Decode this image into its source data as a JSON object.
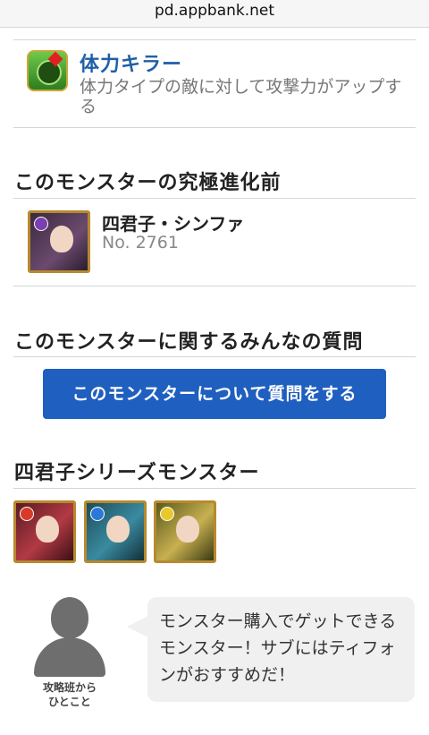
{
  "browser": {
    "url": "pd.appbank.net"
  },
  "skill": {
    "icon": "killer-skill-icon",
    "title": "体力キラー",
    "description": "体力タイプの敵に対して攻撃力がアップする"
  },
  "pre_evolution": {
    "heading": "このモンスターの究極進化前",
    "monster_name": "四君子・シンファ",
    "monster_no": "No. 2761"
  },
  "questions": {
    "heading": "このモンスターに関するみんなの質問",
    "button_label": "このモンスターについて質問をする"
  },
  "series": {
    "heading": "四君子シリーズモンスター",
    "monsters": [
      "monster-1",
      "monster-2",
      "monster-3"
    ]
  },
  "comment": {
    "author_label_line1": "攻略班から",
    "author_label_line2": "ひとこと",
    "text": "モンスター購入でゲットできるモンスター！サブにはティフォンがおすすめだ！"
  },
  "colors": {
    "link_blue": "#1f5fa8",
    "button_blue": "#1f5fbf",
    "thumb_border": "#b8892e"
  }
}
